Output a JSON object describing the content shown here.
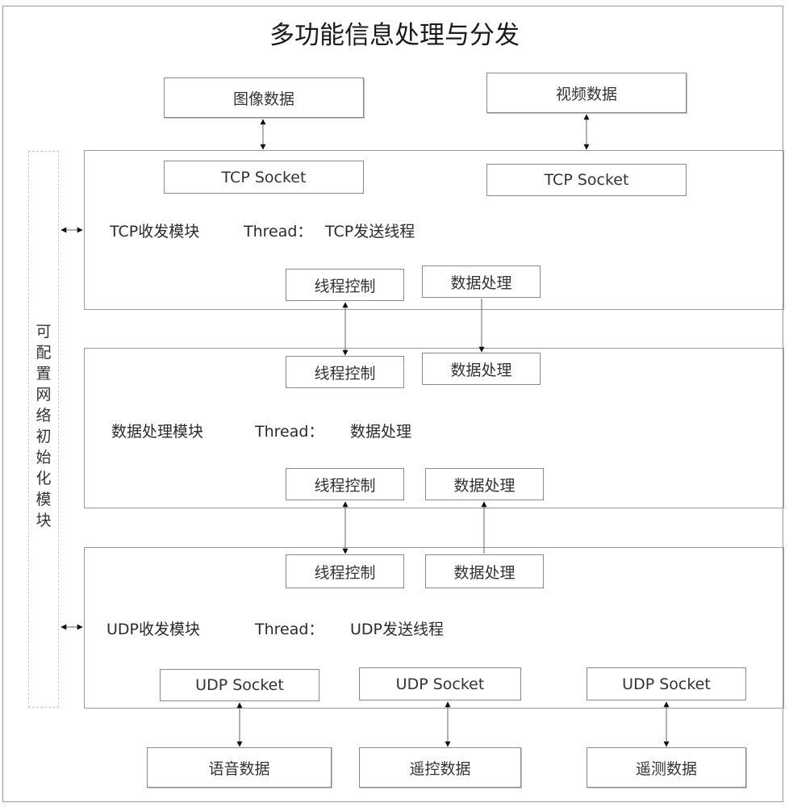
{
  "title": "多功能信息处理与分发",
  "sources_top": {
    "image_data": "图像数据",
    "video_data": "视频数据"
  },
  "side_module": {
    "label": "可配置网络初始化模块",
    "chars": [
      "可",
      "配",
      "置",
      "网",
      "络",
      "初",
      "始",
      "化",
      "模",
      "块"
    ]
  },
  "tcp_module": {
    "socket_left": "TCP Socket",
    "socket_right": "TCP Socket",
    "name": "TCP收发模块",
    "thread_label": "Thread：",
    "thread_value": "TCP发送线程",
    "thread_control": "线程控制",
    "data_processing": "数据处理"
  },
  "data_module": {
    "thread_control_top": "线程控制",
    "data_processing_top": "数据处理",
    "name": "数据处理模块",
    "thread_label": "Thread：",
    "thread_value": "数据处理",
    "thread_control_bottom": "线程控制",
    "data_processing_bottom": "数据处理"
  },
  "udp_module": {
    "thread_control": "线程控制",
    "data_processing": "数据处理",
    "name": "UDP收发模块",
    "thread_label": "Thread：",
    "thread_value": "UDP发送线程",
    "sockets": [
      "UDP Socket",
      "UDP Socket",
      "UDP Socket"
    ]
  },
  "sinks_bottom": {
    "voice_data": "语音数据",
    "remote_control_data": "遥控数据",
    "telemetry_data": "遥测数据"
  }
}
